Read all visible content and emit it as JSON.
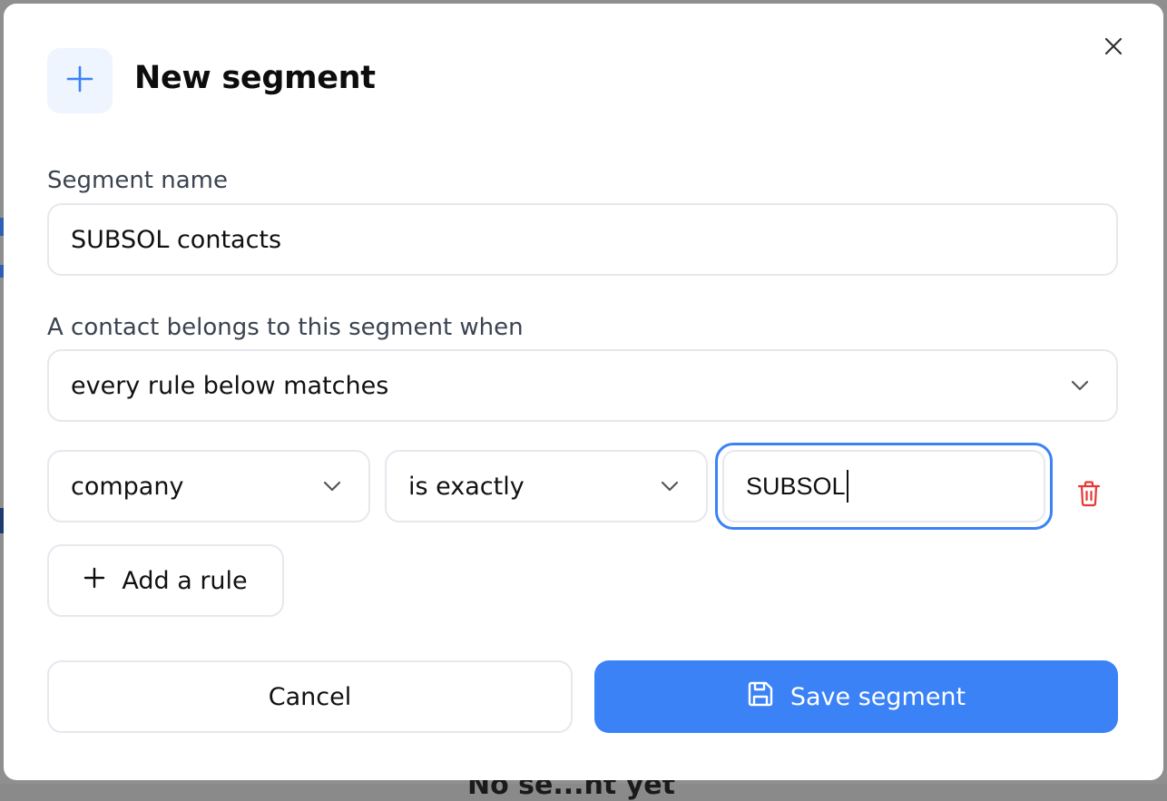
{
  "background": {
    "fragment_text": "No se...nt yet"
  },
  "modal": {
    "title": "New segment",
    "header_icon": "plus-icon",
    "close_icon": "close-icon"
  },
  "form": {
    "segment_name_label": "Segment name",
    "segment_name_value": "SUBSOL contacts",
    "match_label": "A contact belongs to this segment when",
    "match_value": "every rule below matches",
    "rules": [
      {
        "field": "company",
        "operator": "is exactly",
        "value": "SUBSOL"
      }
    ],
    "add_rule_label": "Add a rule"
  },
  "actions": {
    "cancel_label": "Cancel",
    "save_label": "Save segment"
  },
  "colors": {
    "accent": "#3b82f6",
    "icon_tile_bg": "#eef5ff",
    "delete": "#e53935",
    "border": "#e7e7ee",
    "label": "#3b4350"
  }
}
